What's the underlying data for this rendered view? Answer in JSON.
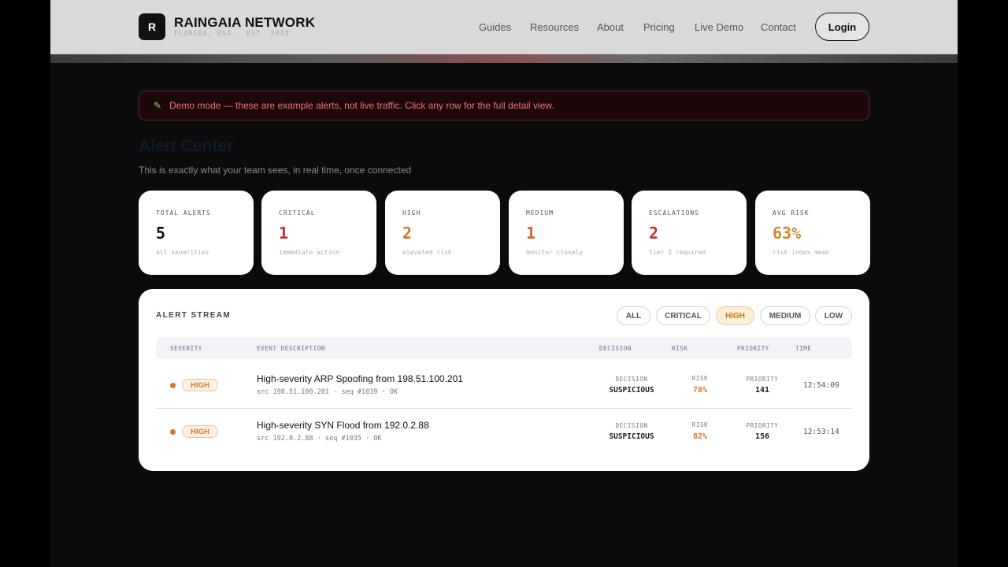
{
  "header": {
    "logo_letter": "R",
    "brand": "RAINGAIA NETWORK",
    "tagline": "FLORIDA, USA · EST. 2025",
    "nav": [
      "Guides",
      "Resources",
      "About",
      "Pricing",
      "Live Demo",
      "Contact"
    ],
    "login": "Login"
  },
  "banner": {
    "icon": "pencil-icon",
    "text": "Demo mode — these are example alerts, not live traffic. Click any row for the full detail view."
  },
  "page": {
    "title": "Alert Center",
    "subtitle": "This is exactly what your team sees, in real time, once connected"
  },
  "stats": [
    {
      "label": "TOTAL ALERTS",
      "value": "5",
      "sub": "all severities",
      "color": "#111111"
    },
    {
      "label": "CRITICAL",
      "value": "1",
      "sub": "immediate action",
      "color": "#c0312b"
    },
    {
      "label": "HIGH",
      "value": "2",
      "sub": "elevated risk",
      "color": "#d0782a"
    },
    {
      "label": "MEDIUM",
      "value": "1",
      "sub": "monitor closely",
      "color": "#d0682a"
    },
    {
      "label": "ESCALATIONS",
      "value": "2",
      "sub": "tier 2 required",
      "color": "#c0312b"
    },
    {
      "label": "AVG RISK",
      "value": "63%",
      "sub": "risk index mean",
      "color": "#d0882a"
    }
  ],
  "stream": {
    "title": "ALERT STREAM",
    "filters": [
      "ALL",
      "CRITICAL",
      "HIGH",
      "MEDIUM",
      "LOW"
    ],
    "active_filter": "HIGH",
    "columns": [
      "SEVERITY",
      "EVENT DESCRIPTION",
      "DECISION",
      "RISK",
      "PRIORITY",
      "TIME"
    ],
    "rows": [
      {
        "severity": "HIGH",
        "description": "High-severity ARP Spoofing from 198.51.100.201",
        "meta": "src 198.51.100.201 · seq #1039 · OK",
        "decision_label": "DECISION",
        "decision": "SUSPICIOUS",
        "risk_label": "RISK",
        "risk": "78%",
        "priority_label": "PRIORITY",
        "priority": "141",
        "time": "12:54:09"
      },
      {
        "severity": "HIGH",
        "description": "High-severity SYN Flood from 192.0.2.88",
        "meta": "src 192.0.2.88 · seq #1035 · OK",
        "decision_label": "DECISION",
        "decision": "SUSPICIOUS",
        "risk_label": "RISK",
        "risk": "82%",
        "priority_label": "PRIORITY",
        "priority": "156",
        "time": "12:53:14"
      }
    ]
  },
  "colors": {
    "accent_high": "#d0782a",
    "critical": "#c0312b",
    "banner_text": "#f07272"
  }
}
